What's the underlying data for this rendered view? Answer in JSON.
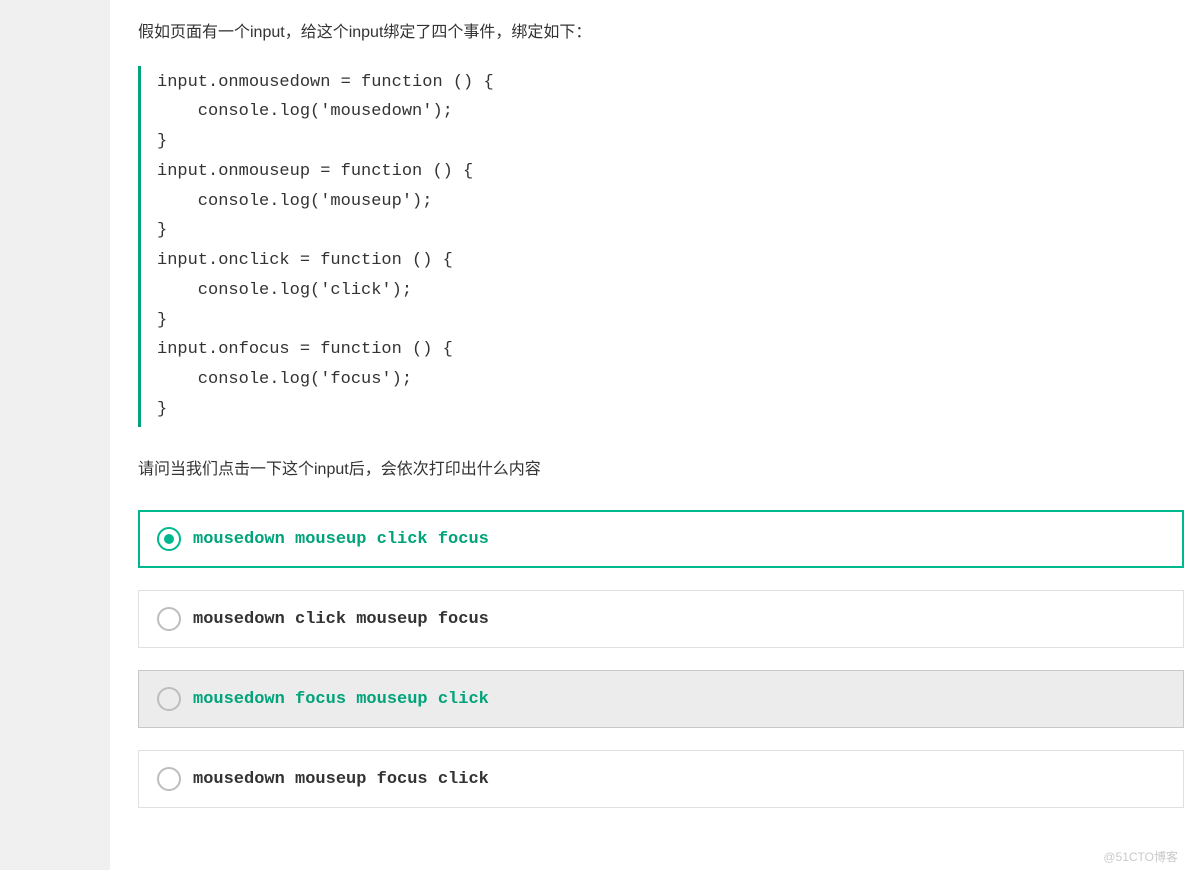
{
  "question_intro": "假如页面有一个input，给这个input绑定了四个事件，绑定如下：",
  "code": "input.onmousedown = function () {\n    console.log('mousedown');\n}\ninput.onmouseup = function () {\n    console.log('mouseup');\n}\ninput.onclick = function () {\n    console.log('click');\n}\ninput.onfocus = function () {\n    console.log('focus');\n}",
  "question_followup": "请问当我们点击一下这个input后，会依次打印出什么内容",
  "options": [
    {
      "label": "mousedown mouseup click  focus",
      "selected": true,
      "correct": false
    },
    {
      "label": "mousedown click mouseup focus",
      "selected": false,
      "correct": false
    },
    {
      "label": "mousedown focus mouseup click",
      "selected": false,
      "correct": true
    },
    {
      "label": "mousedown mouseup focus click",
      "selected": false,
      "correct": false
    }
  ],
  "watermark": "@51CTO博客"
}
